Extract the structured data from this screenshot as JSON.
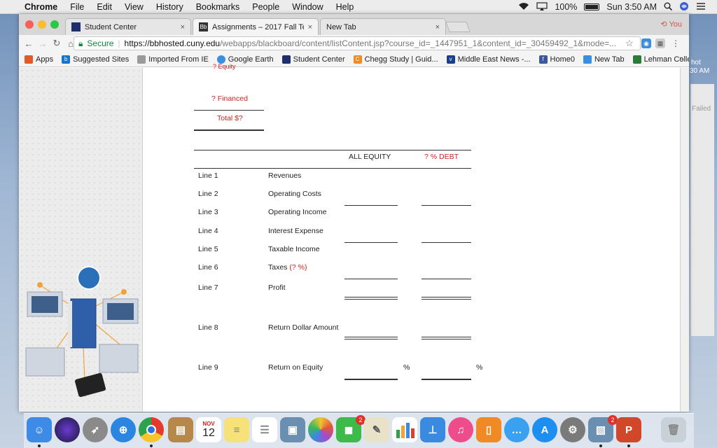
{
  "menubar": {
    "app": "Chrome",
    "items": [
      "File",
      "Edit",
      "View",
      "History",
      "Bookmarks",
      "People",
      "Window",
      "Help"
    ],
    "battery": "100%",
    "clock": "Sun 3:50 AM"
  },
  "tabs": [
    {
      "label": "Student Center",
      "close": "×"
    },
    {
      "label": "Assignments – 2017 Fall Term",
      "close": "×"
    },
    {
      "label": "New Tab",
      "close": "×"
    }
  ],
  "profile": "You",
  "omnibox": {
    "secure_label": "Secure",
    "host": "https://bbhosted.cuny.edu",
    "path": "/webapps/blackboard/content/listContent.jsp?course_id=_1447951_1&content_id=_30459492_1&mode=..."
  },
  "bookmarks": [
    {
      "label": "Apps",
      "color": "#e05a2a"
    },
    {
      "label": "Suggested Sites",
      "color": "#1b74c8"
    },
    {
      "label": "Imported From IE",
      "color": "#9a9a9a"
    },
    {
      "label": "Google Earth",
      "color": "#3b8fe0"
    },
    {
      "label": "Student Center",
      "color": "#1e2f6b"
    },
    {
      "label": "Chegg Study | Guid...",
      "color": "#f08a24"
    },
    {
      "label": "Middle East News -...",
      "color": "#1a3e8a"
    },
    {
      "label": "Home0",
      "color": "#3b5998"
    },
    {
      "label": "New Tab",
      "color": "#3b8fe0"
    },
    {
      "label": "Lehman College",
      "color": "#2a7a3a"
    }
  ],
  "bookmarks_more": "»",
  "desktop": {
    "side_text_1": "hot",
    "side_text_2": "30 AM",
    "side_text_3": "Failed"
  },
  "worksheet": {
    "top_partial": "? Equity",
    "financed": "? Financed",
    "total": "Total $?",
    "col_equity": "ALL EQUITY",
    "col_debt": "? % DEBT",
    "rows": [
      {
        "line": "Line 1",
        "label": "Revenues"
      },
      {
        "line": "Line 2",
        "label": "Operating Costs"
      },
      {
        "line": "Line 3",
        "label": "Operating Income"
      },
      {
        "line": "Line 4",
        "label": "Interest Expense"
      },
      {
        "line": "Line 5",
        "label": "Taxable Income"
      },
      {
        "line": "Line 6",
        "label": "Taxes",
        "red_suffix": "(? %)"
      },
      {
        "line": "Line 7",
        "label": "Profit"
      },
      {
        "line": "Line 8",
        "label": "Return Dollar Amount"
      },
      {
        "line": "Line 9",
        "label": "Return on Equity"
      }
    ],
    "percent_symbol": "%"
  },
  "dock": {
    "calendar_month": "NOV",
    "calendar_day": "12",
    "facetime_badge": "2",
    "preview_badge": "2",
    "colors": {
      "finder": "#3d8be6",
      "siri": "#2a2a4a",
      "launchpad": "#8a8a8a",
      "safari": "#2a86e0",
      "chrome": "#e8e8e8",
      "contacts": "#b6884a",
      "calendar": "#ffffff",
      "notes": "#f7e27a",
      "reminders": "#ffffff",
      "preview": "#6b8fb0",
      "photos": "#ffffff",
      "facetime": "#3cba4a",
      "messages": "#3aa0f0",
      "appstore": "#1e8ef0",
      "prefs": "#7a7a7a",
      "powerpoint": "#d0472a",
      "trash": "#c8d0d8"
    }
  }
}
